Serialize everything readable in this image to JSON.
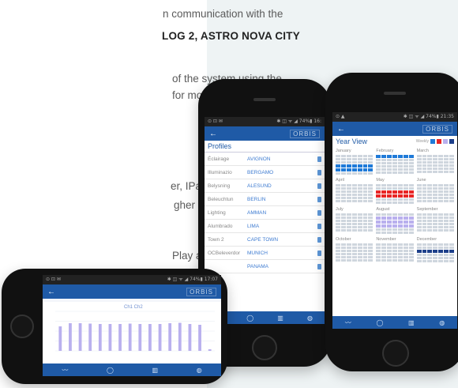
{
  "text_lines": [
    "n communication with the",
    "LOG 2, ASTRO NOVA CITY",
    "of the system using the",
    "for mobile phones with",
    "er, IPad 3 or higher)",
    "gher and compatible",
    "Play and App Store"
  ],
  "profiles_phone": {
    "status_left": "⊙ ⊡ ✉",
    "status_right": "✱ ◫ ᯤ ◢ 74%▮ 16:",
    "back_icon": "←",
    "brand": "ORBIS",
    "title": "Profiles",
    "rows": [
      {
        "name": "Éclairage",
        "place": "AVIGNON"
      },
      {
        "name": "Illuminazio",
        "place": "BERGAMO"
      },
      {
        "name": "Belysning",
        "place": "ALESUND"
      },
      {
        "name": "Beleuchtun",
        "place": "BERLIN"
      },
      {
        "name": "Lighting",
        "place": "AMMAN"
      },
      {
        "name": "Alumbrado",
        "place": "LIMA"
      },
      {
        "name": "Town 2",
        "place": "CAPE TOWN"
      },
      {
        "name": "OCBeleverdor",
        "place": "MUNICH"
      },
      {
        "name": "",
        "place": "PANAMA"
      }
    ]
  },
  "yearview_phone": {
    "status_left": "⊙ ▲",
    "status_right": "✱ ◫ ᯤ ◢ 74%▮ 21:35",
    "back_icon": "←",
    "brand": "ORBIS",
    "title": "Year View",
    "legend_label": "Weekly",
    "months": [
      "January",
      "February",
      "March",
      "April",
      "May",
      "June",
      "July",
      "August",
      "September",
      "October",
      "November",
      "December"
    ],
    "colors": {
      "blue": "#1f7ad8",
      "red": "#e82626",
      "lavender": "#b9b0ee",
      "navy": "#1d3f8a"
    }
  },
  "chart_phone": {
    "status_left": "⊙ ⊡ ✉",
    "status_right": "✱ ◫ ᯤ ◢ 74%▮ 17:07",
    "back_icon": "←",
    "brand": "ORBIS",
    "legend": "Ch1  Ch2",
    "chart_data": {
      "type": "bar",
      "values": [
        62,
        70,
        70,
        69,
        68,
        68,
        68,
        69,
        68,
        68,
        68,
        70,
        71,
        68,
        66,
        4
      ],
      "ylim": [
        0,
        100
      ]
    }
  },
  "nav_icons": [
    "chart-line-icon",
    "circle-icon",
    "bar-chart-icon",
    "globe-icon"
  ]
}
